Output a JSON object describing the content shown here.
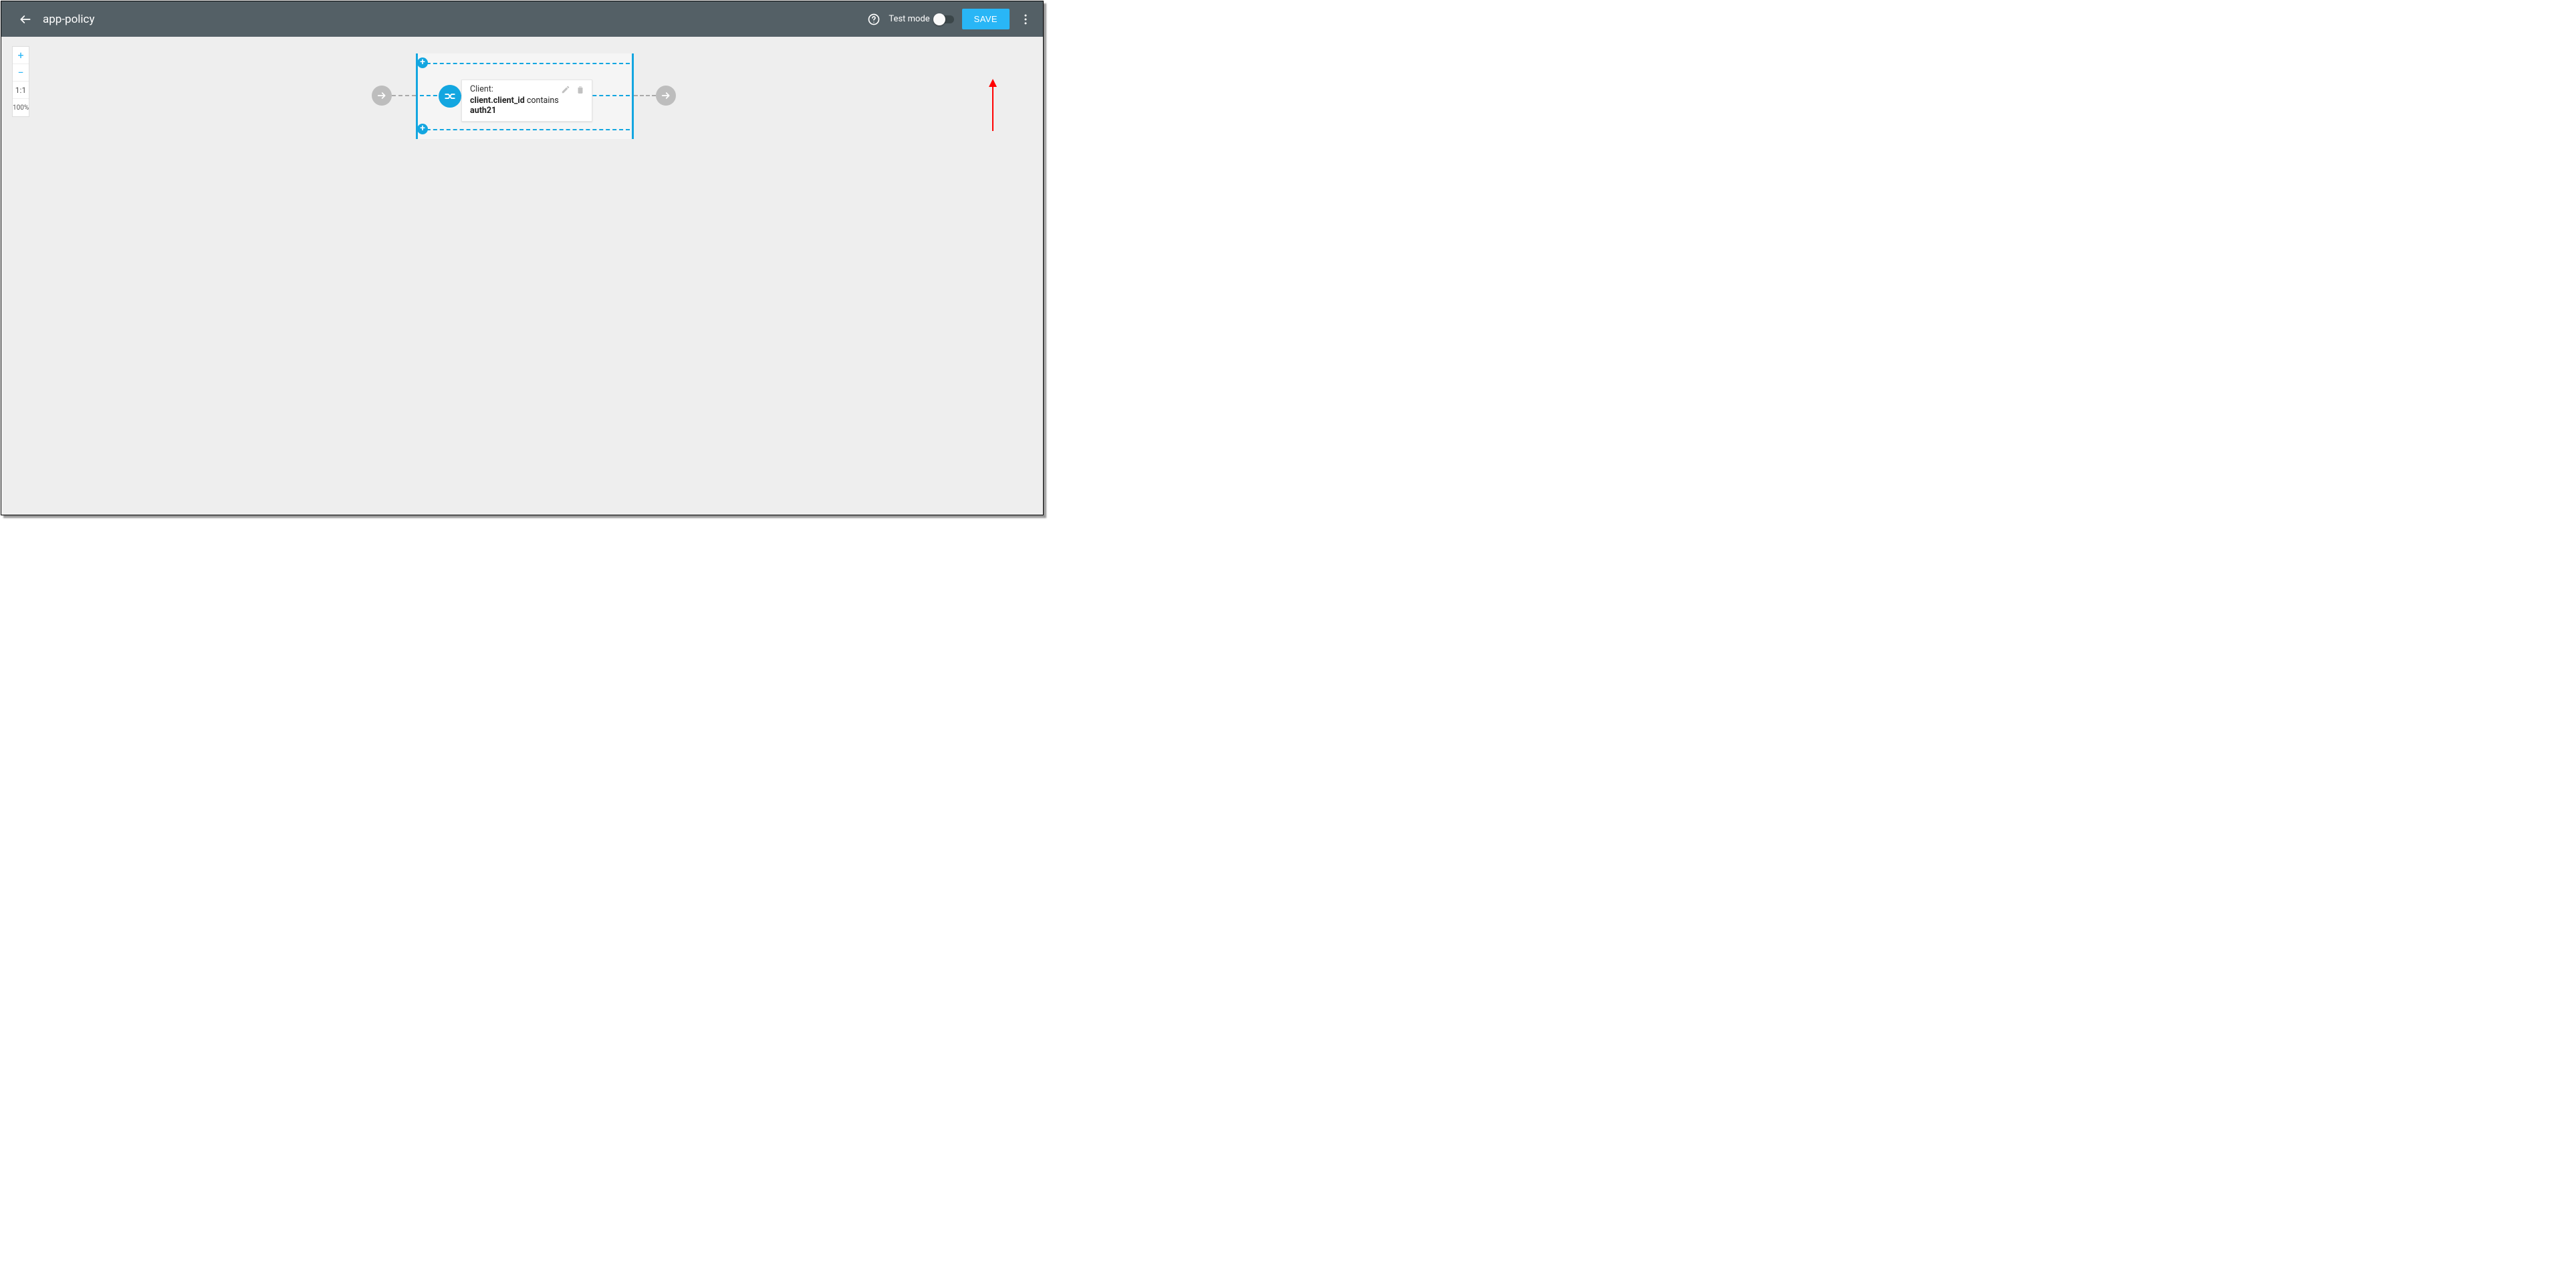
{
  "header": {
    "title": "app-policy",
    "help_tooltip": "Help",
    "test_mode_label": "Test mode",
    "test_mode_on": false,
    "save_label": "SAVE"
  },
  "zoom": {
    "plus": "+",
    "minus": "−",
    "one_to_one": "1:1",
    "percent": "100%"
  },
  "flow": {
    "start_icon": "arrow-right",
    "end_icon": "arrow-right",
    "group": {
      "add_top": "+",
      "add_bottom": "+"
    },
    "rule": {
      "icon": "branch",
      "title": "Client:",
      "expression": {
        "field": "client.client_id",
        "operator": "contains",
        "value": "auth21"
      },
      "actions": {
        "edit": "edit",
        "delete": "delete"
      }
    }
  }
}
